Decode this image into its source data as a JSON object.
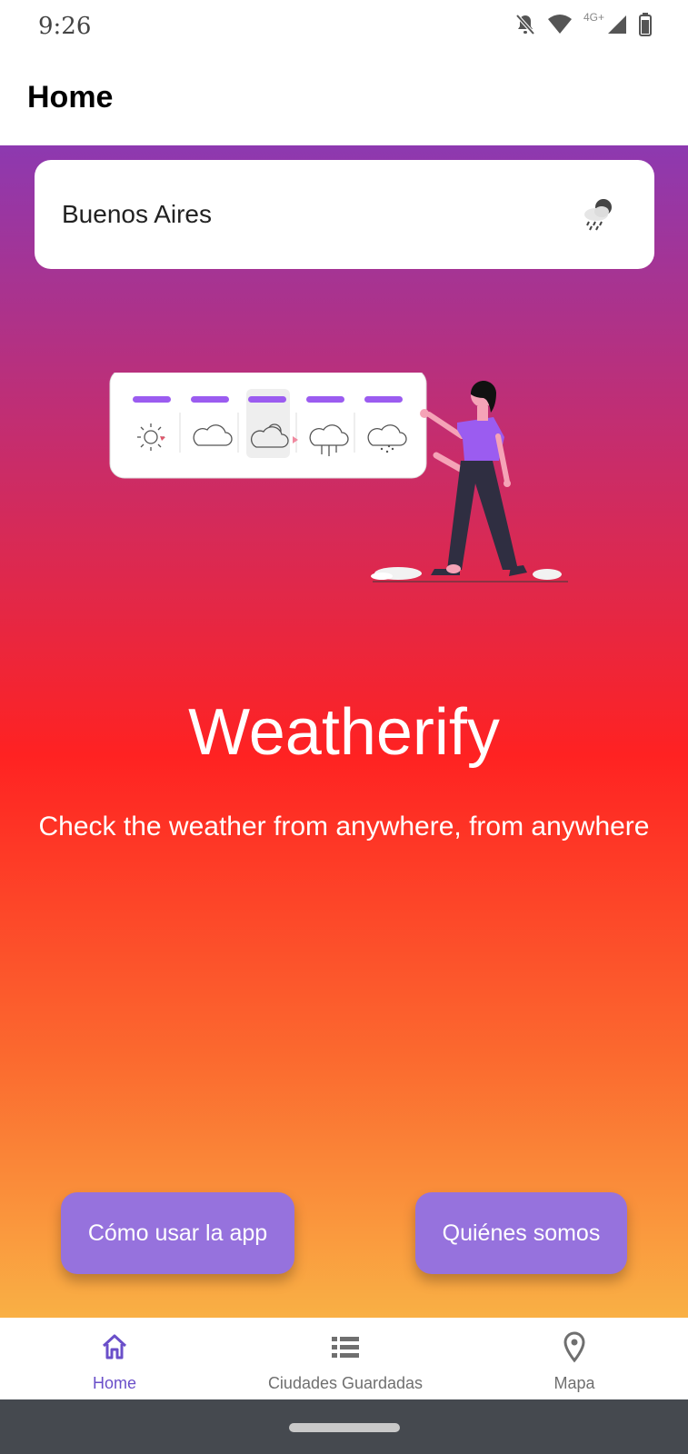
{
  "status_bar": {
    "time": "9:26",
    "network": "4G+"
  },
  "app_bar": {
    "title": "Home"
  },
  "city_card": {
    "city": "Buenos Aires",
    "icon": "rain-cloud-icon"
  },
  "hero": {
    "title": "Weatherify",
    "subtitle": "Check the weather from anywhere, from anywhere"
  },
  "buttons": {
    "how_to": "Cómo usar la app",
    "about": "Quiénes somos"
  },
  "nav": {
    "items": [
      {
        "label": "Home",
        "icon": "home-icon",
        "active": true
      },
      {
        "label": "Ciudades Guardadas",
        "icon": "list-icon",
        "active": false
      },
      {
        "label": "Mapa",
        "icon": "map-pin-icon",
        "active": false
      }
    ]
  },
  "colors": {
    "accent": "#9672dd",
    "nav_active": "#6a4fc9",
    "nav_inactive": "#6f6f6f",
    "gradient_top": "#8d39b0",
    "gradient_mid": "#ff2222",
    "gradient_bottom": "#f9b045"
  }
}
